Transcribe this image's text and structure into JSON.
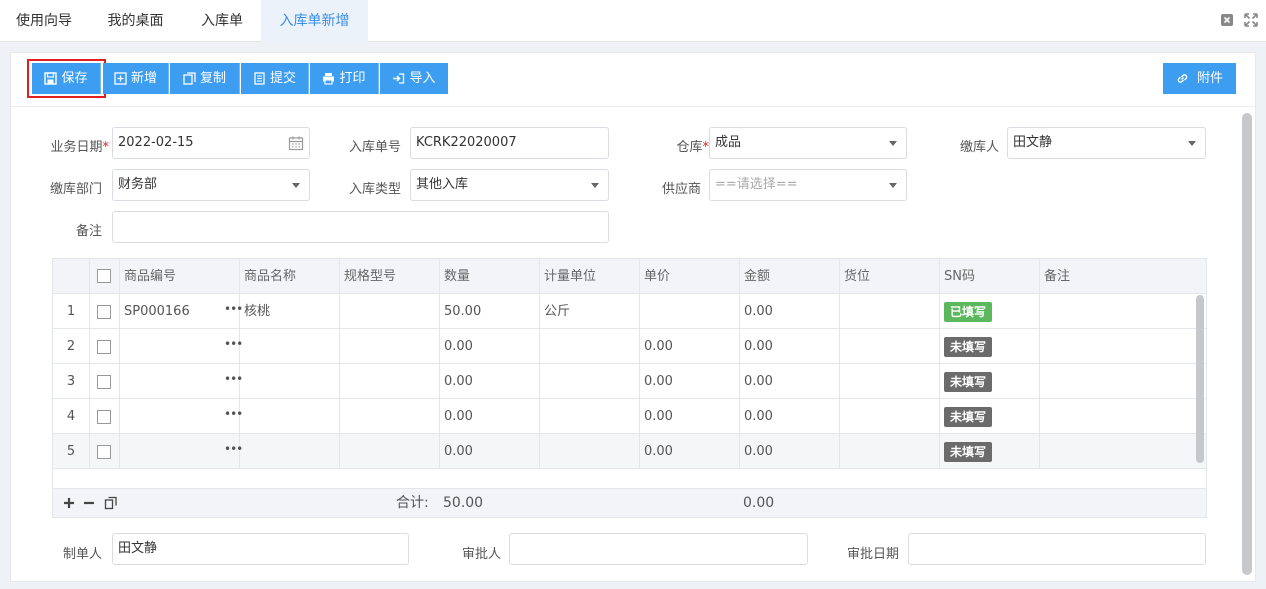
{
  "tabs": [
    {
      "label": "使用向导"
    },
    {
      "label": "我的桌面"
    },
    {
      "label": "入库单"
    },
    {
      "label": "入库单新增",
      "active": true
    }
  ],
  "toolbar": {
    "save": "保存",
    "add": "新增",
    "copy": "复制",
    "submit": "提交",
    "print": "打印",
    "import": "导入",
    "attach": "附件"
  },
  "form": {
    "biz_date_label": "业务日期",
    "biz_date_value": "2022-02-15",
    "order_no_label": "入库单号",
    "order_no_value": "KCRK22020007",
    "warehouse_label": "仓库",
    "warehouse_value": "成品",
    "payer_label": "缴库人",
    "payer_value": "田文静",
    "dept_label": "缴库部门",
    "dept_value": "财务部",
    "type_label": "入库类型",
    "type_value": "其他入库",
    "supplier_label": "供应商",
    "supplier_placeholder": "==请选择==",
    "remark_label": "备注",
    "remark_value": "",
    "required_mark": "*"
  },
  "table": {
    "columns": [
      "商品编号",
      "商品名称",
      "规格型号",
      "数量",
      "计量单位",
      "单价",
      "金额",
      "货位",
      "SN码",
      "备注"
    ],
    "rows": [
      {
        "no": "1",
        "code": "SP000166",
        "name": "核桃",
        "spec": "",
        "qty": "50.00",
        "unit": "公斤",
        "price": "",
        "amount": "0.00",
        "loc": "",
        "sn": "已填写",
        "sn_done": true,
        "remark": ""
      },
      {
        "no": "2",
        "code": "",
        "name": "",
        "spec": "",
        "qty": "0.00",
        "unit": "",
        "price": "0.00",
        "amount": "0.00",
        "loc": "",
        "sn": "未填写",
        "sn_done": false,
        "remark": ""
      },
      {
        "no": "3",
        "code": "",
        "name": "",
        "spec": "",
        "qty": "0.00",
        "unit": "",
        "price": "0.00",
        "amount": "0.00",
        "loc": "",
        "sn": "未填写",
        "sn_done": false,
        "remark": ""
      },
      {
        "no": "4",
        "code": "",
        "name": "",
        "spec": "",
        "qty": "0.00",
        "unit": "",
        "price": "0.00",
        "amount": "0.00",
        "loc": "",
        "sn": "未填写",
        "sn_done": false,
        "remark": ""
      },
      {
        "no": "5",
        "code": "",
        "name": "",
        "spec": "",
        "qty": "0.00",
        "unit": "",
        "price": "0.00",
        "amount": "0.00",
        "loc": "",
        "sn": "未填写",
        "sn_done": false,
        "remark": ""
      }
    ],
    "ellipsis": "•••",
    "total_label": "合计:",
    "total_qty": "50.00",
    "total_amount": "0.00"
  },
  "bottom": {
    "creator_label": "制单人",
    "creator_value": "田文静",
    "approver_label": "审批人",
    "approver_value": "",
    "approve_date_label": "审批日期",
    "approve_date_value": ""
  },
  "colors": {
    "primary": "#3d9df0",
    "active_tab_text": "#3a8ee6",
    "highlight": "#e02020",
    "badge_done": "#5cb85c",
    "badge_todo": "#6b6b6b"
  }
}
